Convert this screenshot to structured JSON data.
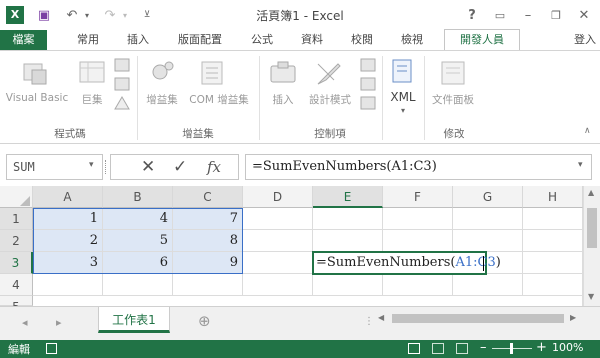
{
  "window": {
    "title": "活頁簿1 - Excel",
    "help": "?",
    "signin": "登入"
  },
  "tabs": [
    "檔案",
    "常用",
    "插入",
    "版面配置",
    "公式",
    "資料",
    "校閱",
    "檢視",
    "開發人員"
  ],
  "active_tab": "開發人員",
  "ribbon": {
    "code_group": {
      "label": "程式碼",
      "visual_basic": "Visual Basic",
      "macros": "巨集"
    },
    "addins_group": {
      "label": "增益集",
      "addins": "增益集",
      "com_addins": "COM 增益集"
    },
    "controls_group": {
      "label": "控制項",
      "insert": "插入",
      "design_mode": "設計模式"
    },
    "xml_group": {
      "label": "",
      "xml": "XML"
    },
    "modify_group": {
      "label": "修改",
      "doc_panel": "文件面板"
    }
  },
  "formula_bar": {
    "name_box": "SUM",
    "cancel": "✕",
    "enter": "✓",
    "fx": "fx",
    "formula": "=SumEvenNumbers(A1:C3)"
  },
  "grid": {
    "columns": [
      "A",
      "B",
      "C",
      "D",
      "E",
      "F",
      "G",
      "H"
    ],
    "rows": [
      "1",
      "2",
      "3",
      "4",
      "5"
    ],
    "cells": [
      [
        "1",
        "4",
        "7"
      ],
      [
        "2",
        "5",
        "8"
      ],
      [
        "3",
        "6",
        "9"
      ]
    ],
    "edit_cell": {
      "prefix": "=SumEvenNumbers(",
      "ref": "A1:C3",
      "suffix": ")"
    }
  },
  "sheets": {
    "active": "工作表1",
    "add": "⊕"
  },
  "status": {
    "mode": "編輯",
    "zoom": "100%"
  },
  "colors": {
    "accent": "#217346",
    "ref_blue": "#3a6fc7"
  }
}
